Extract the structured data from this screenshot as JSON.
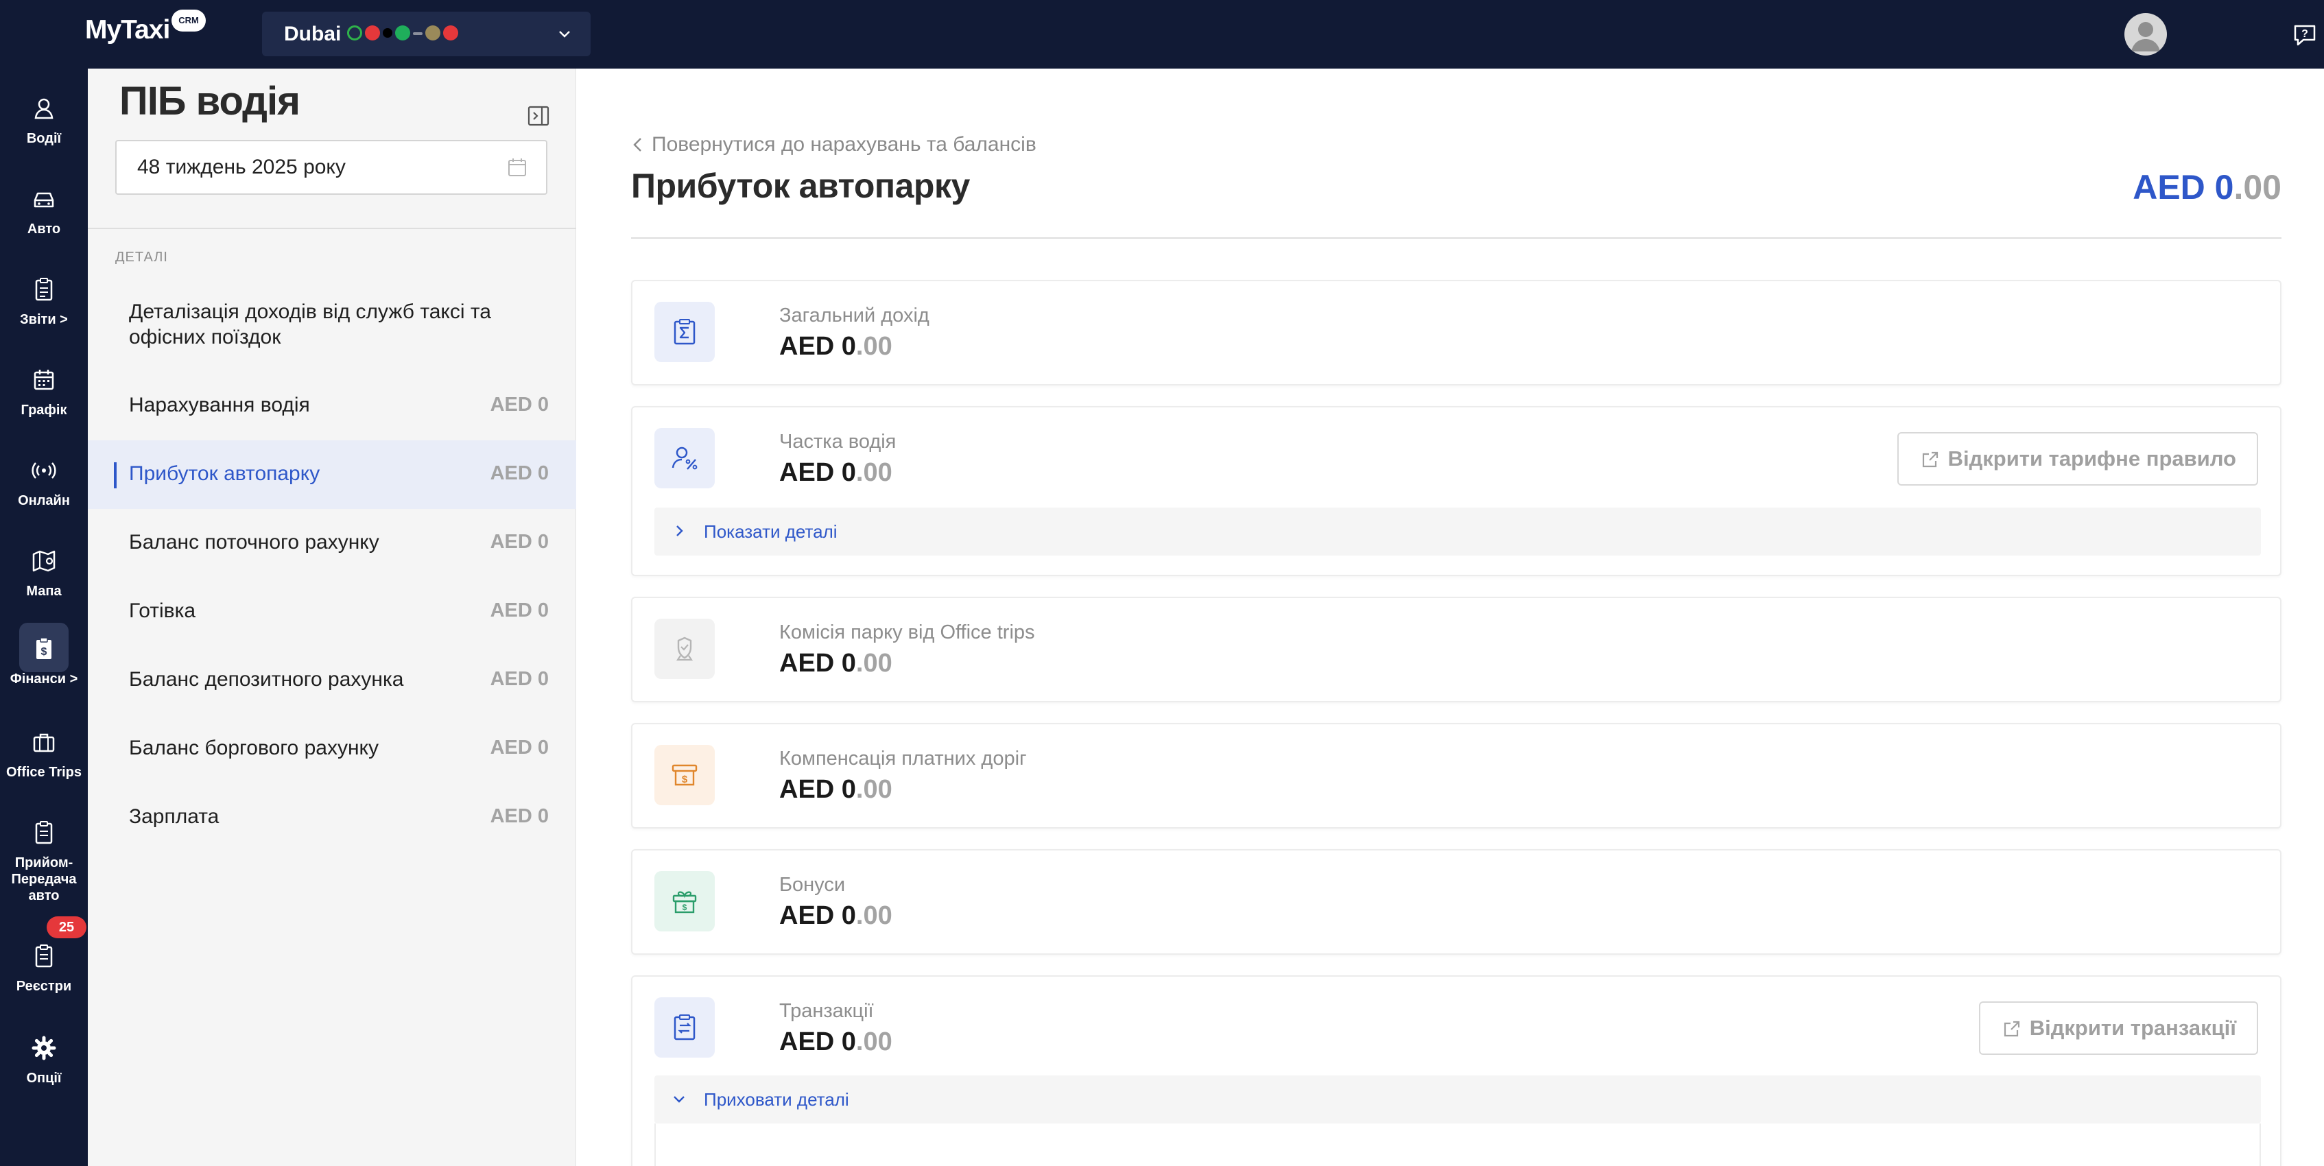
{
  "app": {
    "logo": "MyTaxi",
    "logo_badge": "CRM"
  },
  "city": {
    "name": "Dubai"
  },
  "nav": [
    {
      "label": "Водії",
      "icon": "user-icon"
    },
    {
      "label": "Авто",
      "icon": "car-icon"
    },
    {
      "label": "Звіти >",
      "icon": "clipboard-icon"
    },
    {
      "label": "Графік",
      "icon": "calendar-icon"
    },
    {
      "label": "Онлайн",
      "icon": "broadcast-icon"
    },
    {
      "label": "Мапа",
      "icon": "map-icon"
    },
    {
      "label": "Фінанси >",
      "icon": "finance-icon"
    },
    {
      "label": "Office Trips",
      "icon": "briefcase-icon"
    },
    {
      "label": "Прийом-Передача авто",
      "icon": "handover-icon"
    },
    {
      "label": "Реєстри",
      "icon": "registry-icon"
    },
    {
      "label": "Опції",
      "icon": "gear-icon"
    }
  ],
  "nav_badge": "25",
  "sidebar": {
    "title": "ПІБ водія",
    "week": "48 тиждень 2025 року",
    "section_label": "ДЕТАЛІ",
    "detail_link": "Деталізація доходів від служб таксі та офісних поїздок",
    "items": [
      {
        "name": "Нарахування водія",
        "amount": "AED 0"
      },
      {
        "name": "Прибуток автопарку",
        "amount": "AED 0"
      },
      {
        "name": "Баланс поточного рахунку",
        "amount": "AED 0"
      },
      {
        "name": "Готівка",
        "amount": "AED 0"
      },
      {
        "name": "Баланс депозитного рахунка",
        "amount": "AED 0"
      },
      {
        "name": "Баланс боргового рахунку",
        "amount": "AED 0"
      },
      {
        "name": "Зарплата",
        "amount": "AED 0"
      }
    ]
  },
  "main": {
    "back_link": "Повернутися до нарахувань та балансів",
    "title": "Прибуток автопарку",
    "total_currency": "AED 0",
    "total_decimals": ".00",
    "cards": [
      {
        "label": "Загальний дохід",
        "value": "AED 0",
        "decimals": ".00"
      },
      {
        "label": "Частка водія",
        "value": "AED 0",
        "decimals": ".00",
        "button": "Відкрити тарифне правило",
        "details": "Показати деталі"
      },
      {
        "label": "Комісія парку від Office trips",
        "value": "AED 0",
        "decimals": ".00"
      },
      {
        "label": "Компенсація платних доріг",
        "value": "AED 0",
        "decimals": ".00"
      },
      {
        "label": "Бонуси",
        "value": "AED 0",
        "decimals": ".00"
      },
      {
        "label": "Транзакції",
        "value": "AED 0",
        "decimals": ".00",
        "button": "Відкрити транзакції",
        "details": "Приховати деталі"
      }
    ]
  },
  "colors": {
    "nav_bg": "#111a35",
    "accent": "#2e57c9",
    "muted": "#a3a3a3"
  }
}
